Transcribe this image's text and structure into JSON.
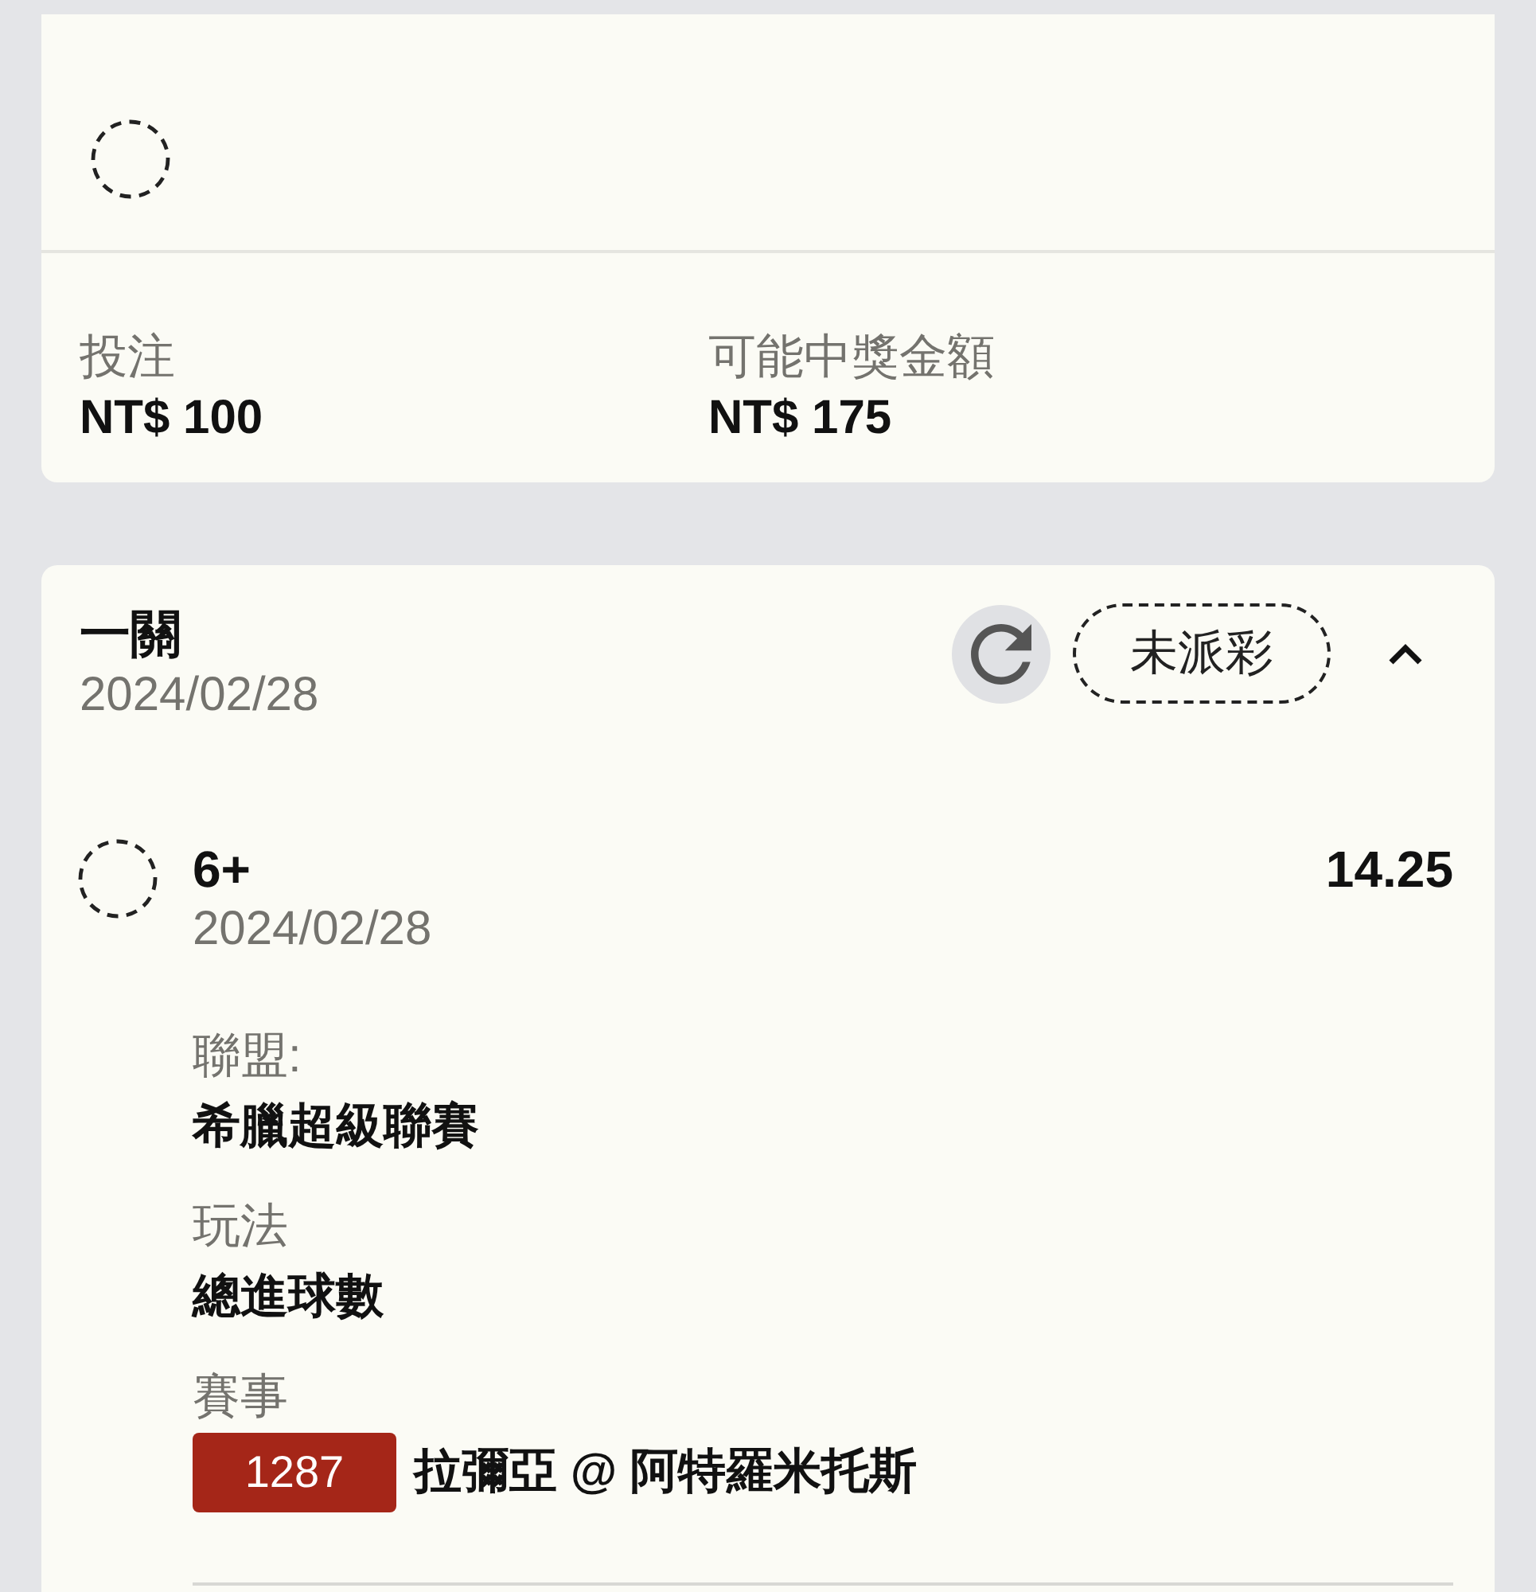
{
  "summary": {
    "fields": [
      {
        "label": "投注",
        "value": "NT$ 100"
      },
      {
        "label": "可能中獎金額",
        "value": "NT$ 175"
      }
    ]
  },
  "bet": {
    "title": "一關",
    "date": "2024/02/28",
    "status": "未派彩",
    "expanded": true,
    "selections": [
      {
        "pick": "6+",
        "date": "2024/02/28",
        "odds": "14.25",
        "details": [
          {
            "kind": "text",
            "label": "聯盟:",
            "value": "希臘超級聯賽"
          },
          {
            "kind": "text",
            "label": "玩法",
            "value": "總進球數"
          },
          {
            "kind": "match",
            "label": "賽事",
            "match_number": "1287",
            "value": "拉彌亞 @ 阿特羅米托斯"
          }
        ]
      }
    ]
  }
}
